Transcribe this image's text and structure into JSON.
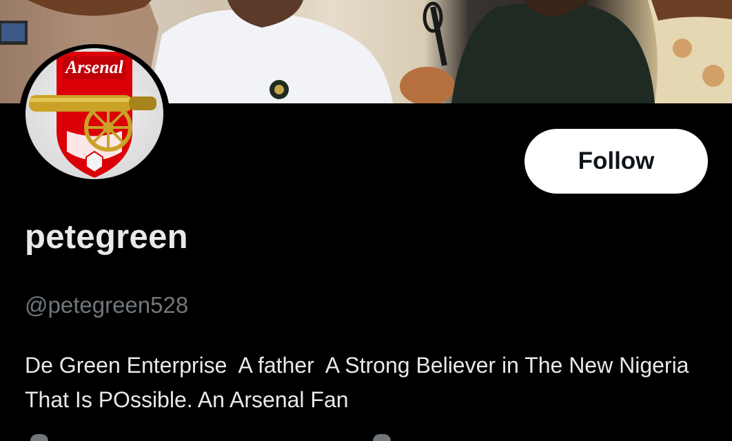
{
  "profile": {
    "display_name": "petegreen",
    "handle": "@petegreen528",
    "bio": "De Green Enterprise  A father  A Strong Believer in The New Nigeria That Is POssible. An Arsenal Fan"
  },
  "avatar": {
    "logo_text": "Arsenal"
  },
  "actions": {
    "follow_label": "Follow"
  },
  "colors": {
    "background": "#000000",
    "primary_text": "#e7e9ea",
    "secondary_text": "#71767b",
    "follow_bg": "#ffffff",
    "arsenal_red": "#db0007"
  }
}
